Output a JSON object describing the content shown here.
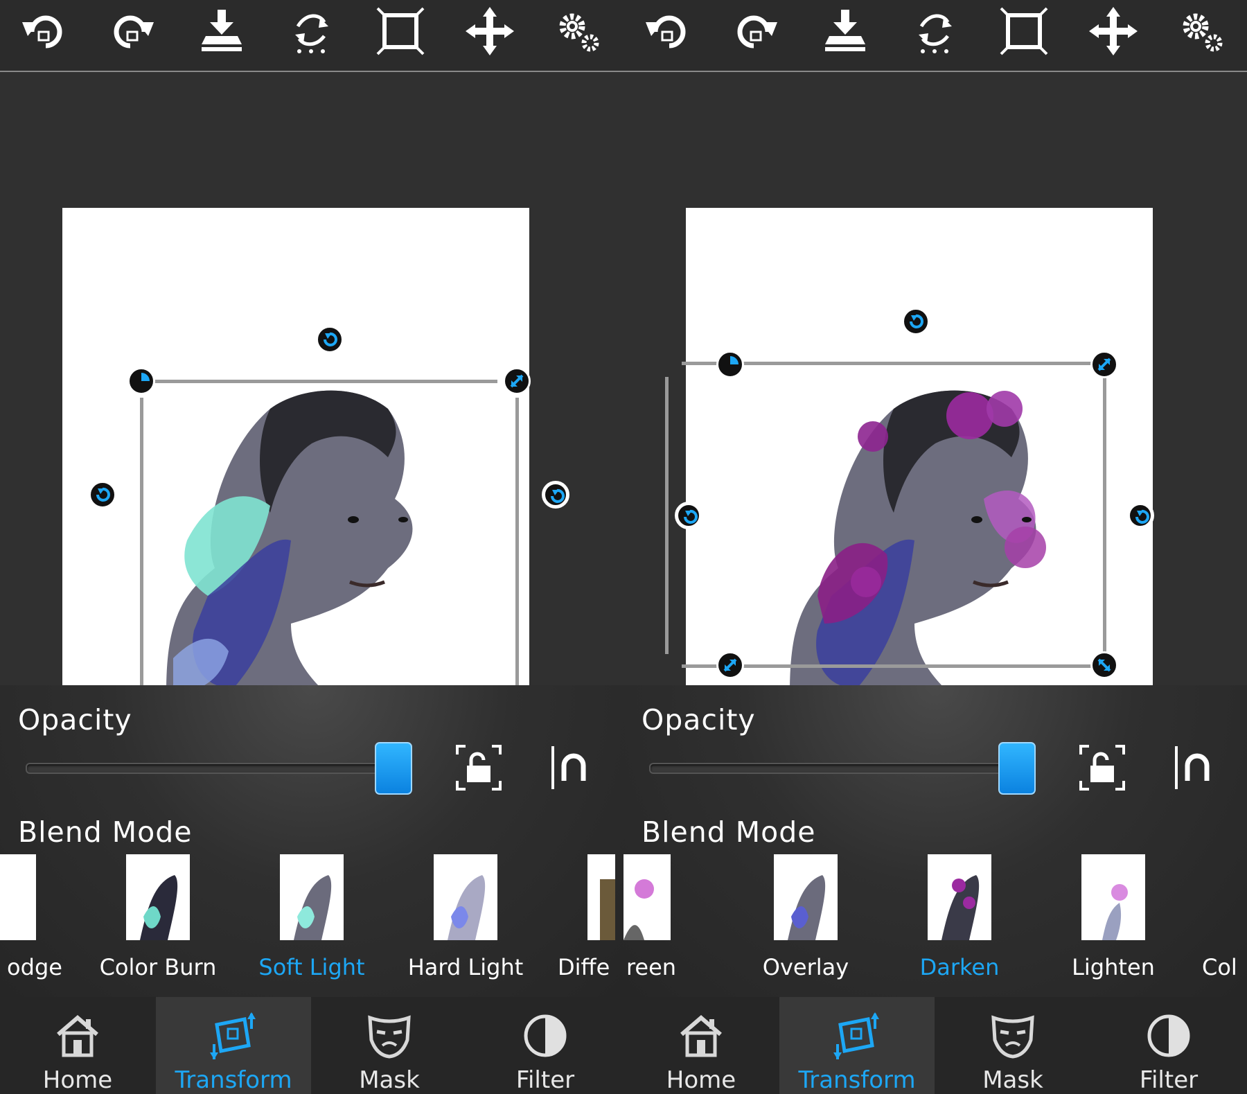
{
  "colors": {
    "accent": "#1da7f5",
    "background": "#2e2e2e",
    "handle_fill": "#111111"
  },
  "toolbar": {
    "buttons": [
      "undo-icon",
      "redo-icon",
      "merge-down-icon",
      "flip-icon",
      "crop-icon",
      "move-icon",
      "settings-icon"
    ]
  },
  "panels": [
    {
      "opacity_label": "Opacity",
      "opacity_value": 1.0,
      "blend_label": "Blend Mode",
      "blend_modes": [
        "odge",
        "Color Burn",
        "Soft Light",
        "Hard Light",
        "Diffe"
      ],
      "selected_blend": "Soft Light"
    },
    {
      "opacity_label": "Opacity",
      "opacity_value": 1.0,
      "blend_label": "Blend Mode",
      "blend_modes": [
        "reen",
        "Overlay",
        "Darken",
        "Lighten",
        "Col"
      ],
      "selected_blend": "Darken"
    }
  ],
  "nav": {
    "home": "Home",
    "transform": "Transform",
    "mask": "Mask",
    "filter": "Filter",
    "active": "Transform"
  }
}
